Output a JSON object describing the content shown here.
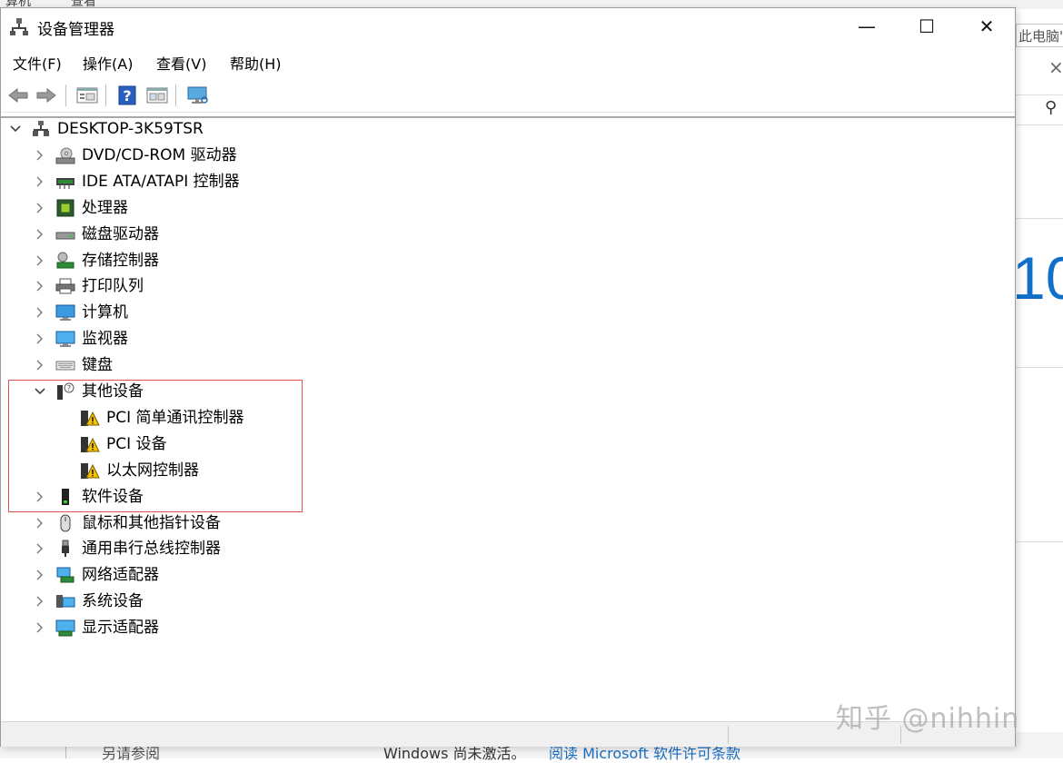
{
  "background": {
    "top_text_1": "算机",
    "top_text_2": "查看",
    "tab_label": "此电脑\"",
    "big_number": "10",
    "bottom_text_1": "另请参阅",
    "bottom_text_2": "Windows 尚未激活。",
    "bottom_link": "阅读 Microsoft 软件许可条款"
  },
  "window": {
    "title": "设备管理器",
    "controls": {
      "minimize": "—",
      "maximize": "☐",
      "close": "✕"
    }
  },
  "menu": {
    "file": "文件(F)",
    "action": "操作(A)",
    "view": "查看(V)",
    "help": "帮助(H)"
  },
  "toolbar": {
    "icons": [
      "back-arrow-icon",
      "forward-arrow-icon",
      "properties-icon",
      "help-icon",
      "show-hide-icon",
      "monitor-icon"
    ]
  },
  "tree": {
    "root": "DESKTOP-3K59TSR",
    "items": [
      {
        "label": "DVD/CD-ROM 驱动器",
        "icon": "dvd-drive-icon"
      },
      {
        "label": "IDE ATA/ATAPI 控制器",
        "icon": "ide-controller-icon"
      },
      {
        "label": "处理器",
        "icon": "processor-icon"
      },
      {
        "label": "磁盘驱动器",
        "icon": "disk-drive-icon"
      },
      {
        "label": "存储控制器",
        "icon": "storage-controller-icon"
      },
      {
        "label": "打印队列",
        "icon": "printer-icon"
      },
      {
        "label": "计算机",
        "icon": "computer-icon"
      },
      {
        "label": "监视器",
        "icon": "monitor-icon"
      },
      {
        "label": "键盘",
        "icon": "keyboard-icon"
      },
      {
        "label": "其他设备",
        "icon": "unknown-device-icon",
        "expanded": true
      },
      {
        "label": "软件设备",
        "icon": "software-device-icon"
      },
      {
        "label": "鼠标和其他指针设备",
        "icon": "mouse-icon"
      },
      {
        "label": "通用串行总线控制器",
        "icon": "usb-icon"
      },
      {
        "label": "网络适配器",
        "icon": "network-adapter-icon"
      },
      {
        "label": "系统设备",
        "icon": "system-device-icon"
      },
      {
        "label": "显示适配器",
        "icon": "display-adapter-icon"
      }
    ],
    "other_devices_children": [
      {
        "label": "PCI 简单通讯控制器",
        "icon": "warning-device-icon"
      },
      {
        "label": "PCI 设备",
        "icon": "warning-device-icon"
      },
      {
        "label": "以太网控制器",
        "icon": "warning-device-icon"
      }
    ]
  },
  "watermark": "知乎 @nihhin",
  "colors": {
    "highlight_border": "#e05050",
    "accent_blue": "#1070c8"
  }
}
